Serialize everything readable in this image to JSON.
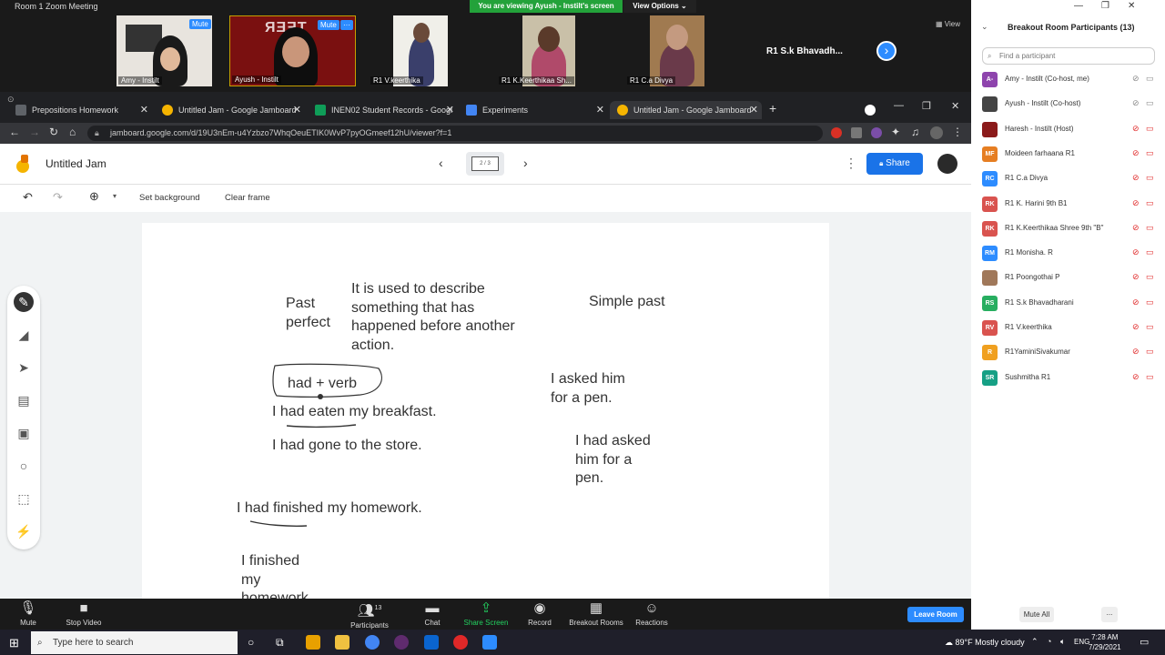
{
  "zoom": {
    "window_title": "Room 1  Zoom Meeting",
    "viewing_banner": "You are viewing Ayush - Instilt's screen",
    "view_options": "View Options",
    "view_label": "View",
    "mute_label": "Mute",
    "more_label": "···",
    "tiles": [
      {
        "name": "Amy - Instilt"
      },
      {
        "name": "Ayush - Instilt"
      },
      {
        "name": "R1 V.keerthika"
      },
      {
        "name": "R1 K.Keerthikaa Sh..."
      },
      {
        "name": "R1 C.a Divya"
      },
      {
        "name": "R1 S.k Bhavadh..."
      }
    ],
    "controls": {
      "mute": "Mute",
      "stop_video": "Stop Video",
      "participants": "Participants",
      "participants_count": "13",
      "chat": "Chat",
      "share_screen": "Share Screen",
      "record": "Record",
      "breakout_rooms": "Breakout Rooms",
      "reactions": "Reactions",
      "leave_room": "Leave Room"
    }
  },
  "browser": {
    "tabs": [
      {
        "label": "Prepositions Homework",
        "color": "#3c4043"
      },
      {
        "label": "Untitled Jam - Google Jamboard",
        "color": "#f5b400"
      },
      {
        "label": "INEN02 Student Records - Googl",
        "color": "#0f9d58"
      },
      {
        "label": "Experiments",
        "color": "#4285f4"
      },
      {
        "label": "Untitled Jam - Google Jamboard",
        "color": "#f5b400"
      }
    ],
    "url": "jamboard.google.com/d/19U3nEm-u4Yzbzo7WhqOeuETIK0WvP7pyOGmeef12hU/viewer?f=1"
  },
  "jamboard": {
    "title": "Untitled Jam",
    "frame_indicator": "2 / 3",
    "share_label": "Share",
    "set_background": "Set background",
    "clear_frame": "Clear frame",
    "canvas_text": {
      "past_perfect_line1": "Past",
      "past_perfect_line2": "perfect",
      "desc1": "It is used to describe",
      "desc2": "something that has",
      "desc3": "happened before another",
      "desc4": "action.",
      "simple_past": "Simple past",
      "had_verb": "had + verb",
      "ex1": "I had eaten my breakfast.",
      "ex2": "I had gone to the store.",
      "ex3": "I had finished my homework.",
      "ex4a": "I finished",
      "ex4b": "my",
      "ex4c": "homework",
      "sp1a": "I asked him",
      "sp1b": "for a pen.",
      "sp2a": "I had asked",
      "sp2b": "him for a",
      "sp2c": "pen."
    }
  },
  "panel": {
    "title": "Breakout Room Participants (13)",
    "search_placeholder": "Find a participant",
    "mute_all": "Mute All",
    "more": "...",
    "participants": [
      {
        "initials": "A-",
        "name": "Amy - Instilt (Co-host, me)",
        "color": "#8e44ad"
      },
      {
        "initials": "",
        "name": "Ayush - Instilt (Co-host)",
        "color": "#444444"
      },
      {
        "initials": "",
        "name": "Haresh - Instilt (Host)",
        "color": "#8b1a1a"
      },
      {
        "initials": "MF",
        "name": "Moideen farhaana R1",
        "color": "#e67e22"
      },
      {
        "initials": "RC",
        "name": "R1 C.a Divya",
        "color": "#2d8cff"
      },
      {
        "initials": "RK",
        "name": "R1 K. Harini 9th B1",
        "color": "#d9534f"
      },
      {
        "initials": "RK",
        "name": "R1 K.Keerthikaa Shree 9th \"B\"",
        "color": "#d9534f"
      },
      {
        "initials": "RM",
        "name": "R1 Monisha. R",
        "color": "#2d8cff"
      },
      {
        "initials": "",
        "name": "R1 Poongothai P",
        "color": "#a0785a"
      },
      {
        "initials": "RS",
        "name": "R1 S.k Bhavadharani",
        "color": "#27ae60"
      },
      {
        "initials": "RV",
        "name": "R1 V.keerthika",
        "color": "#d9534f"
      },
      {
        "initials": "R",
        "name": "R1YaminiSivakumar",
        "color": "#f0a020"
      },
      {
        "initials": "SR",
        "name": "Sushmitha R1",
        "color": "#16a085"
      }
    ]
  },
  "taskbar": {
    "search_placeholder": "Type here to search",
    "weather": "89°F  Mostly cloudy",
    "lang": "ENG",
    "time": "7:28 AM",
    "date": "7/29/2021"
  }
}
